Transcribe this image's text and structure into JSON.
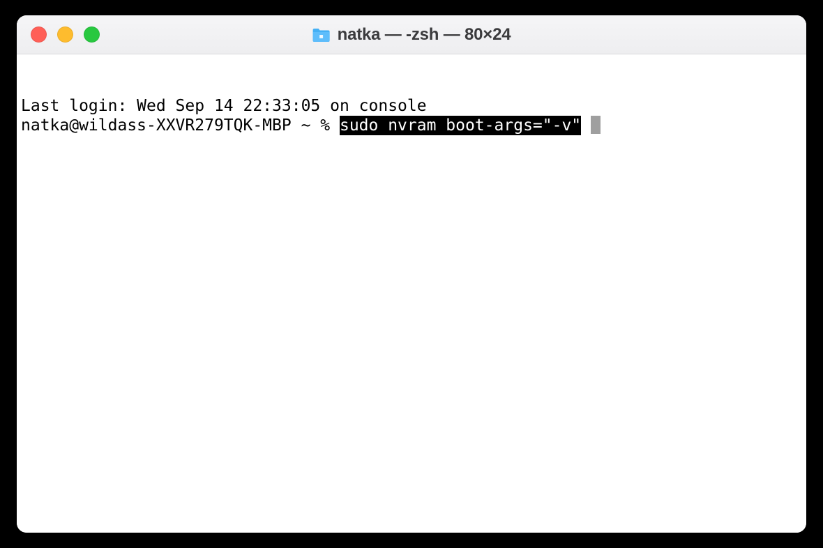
{
  "window": {
    "title": "natka — -zsh — 80×24"
  },
  "terminal": {
    "last_login_line": "Last login: Wed Sep 14 22:33:05 on console",
    "prompt": "natka@wildass-XXVR279TQK-MBP ~ % ",
    "command": "sudo nvram boot-args=\"-v\""
  }
}
